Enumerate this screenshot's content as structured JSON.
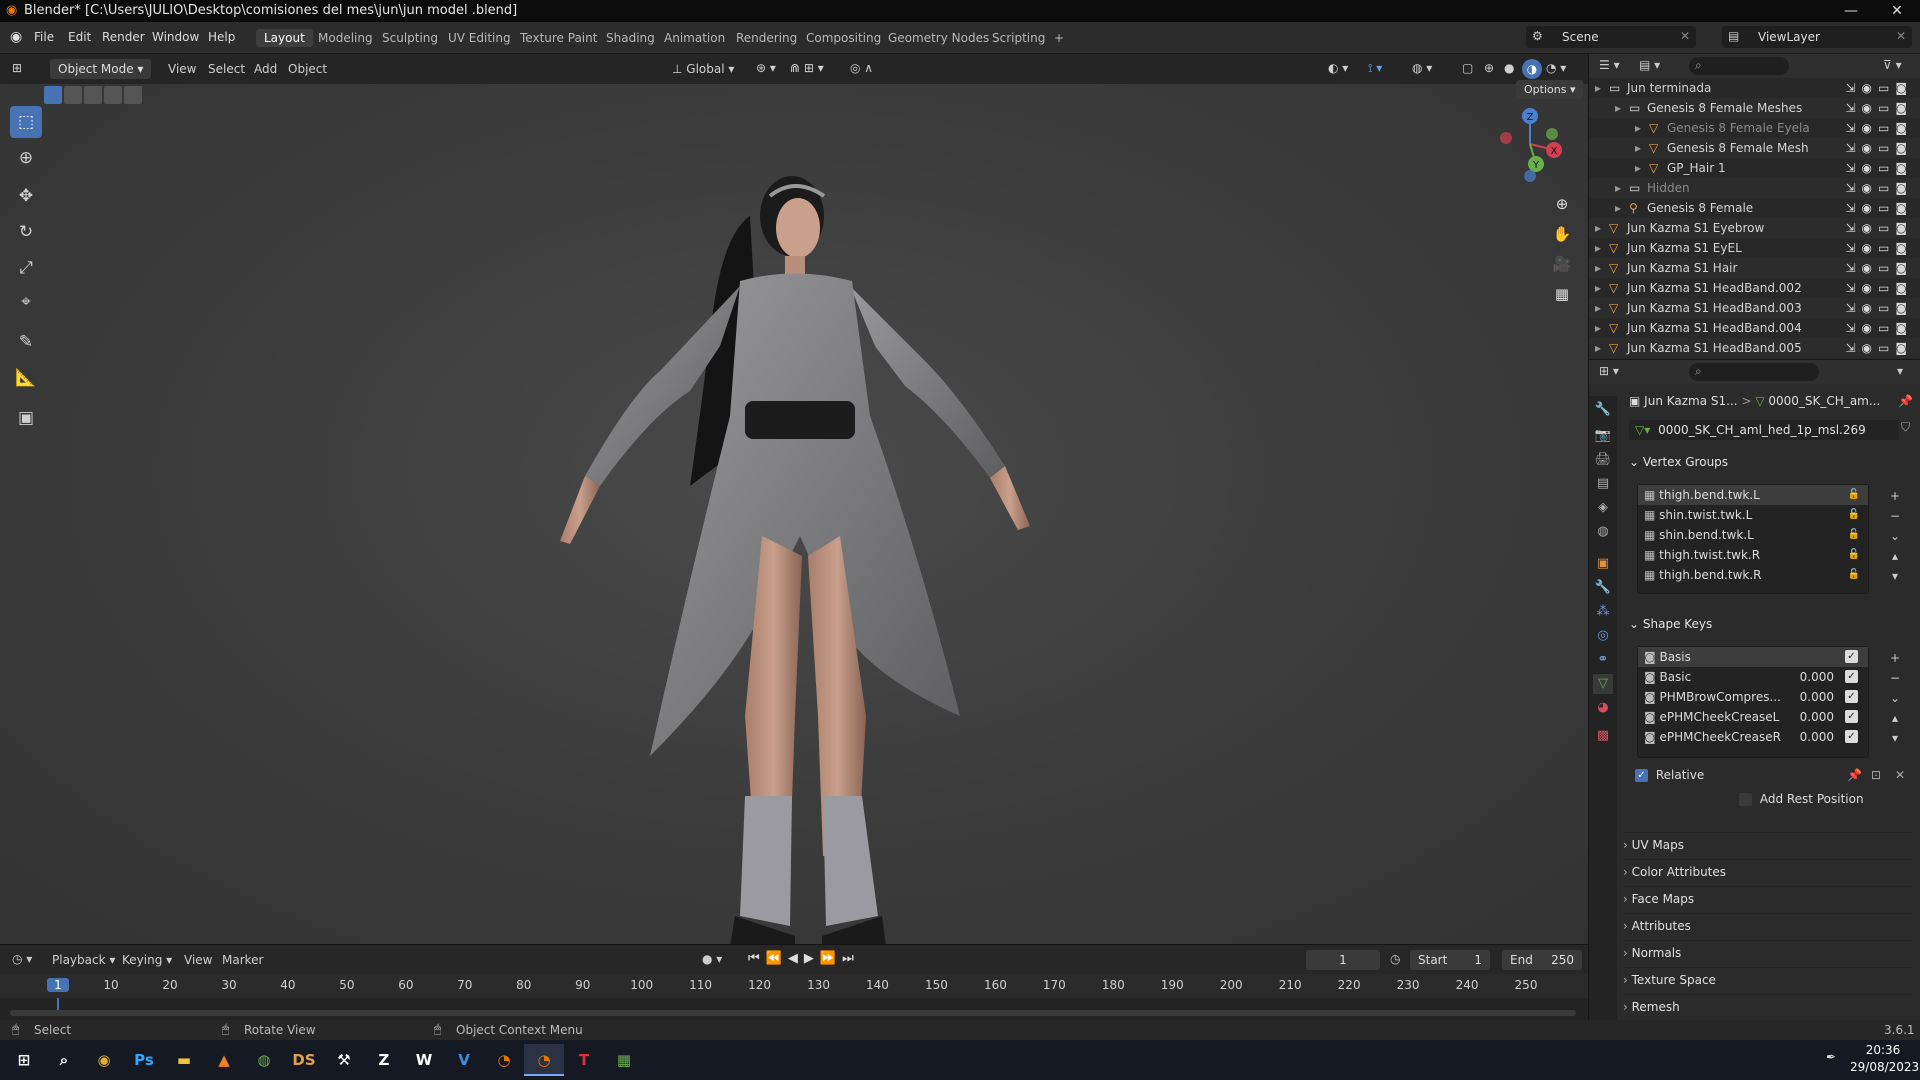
{
  "titlebar": {
    "title": "Blender* [C:\\Users\\JULIO\\Desktop\\comisiones del mes\\jun\\jun model .blend]",
    "min": "—",
    "max": "❐",
    "close": "✕"
  },
  "menubar": {
    "menus": [
      "File",
      "Edit",
      "Render",
      "Window",
      "Help"
    ],
    "workspaces": [
      "Layout",
      "Modeling",
      "Sculpting",
      "UV Editing",
      "Texture Paint",
      "Shading",
      "Animation",
      "Rendering",
      "Compositing",
      "Geometry Nodes",
      "Scripting"
    ],
    "add_workspace": "+",
    "scene_label": "Scene",
    "viewlayer_label": "ViewLayer"
  },
  "viewport_header": {
    "mode": "Object Mode",
    "menus": [
      "View",
      "Select",
      "Add",
      "Object"
    ],
    "orientation": "Global",
    "options": "Options"
  },
  "gizmo": {
    "x": "X",
    "y": "Y",
    "z": "Z"
  },
  "outliner": {
    "rows": [
      {
        "name": "Jun terminada",
        "indent": 0,
        "type": "collection",
        "dim": false
      },
      {
        "name": "Genesis 8 Female Meshes",
        "indent": 1,
        "type": "collection",
        "dim": false
      },
      {
        "name": "Genesis 8 Female Eyela",
        "indent": 2,
        "type": "mesh",
        "dim": true
      },
      {
        "name": "Genesis 8 Female Mesh",
        "indent": 2,
        "type": "mesh",
        "dim": false
      },
      {
        "name": "GP_Hair 1",
        "indent": 2,
        "type": "mesh",
        "dim": false
      },
      {
        "name": "Hidden",
        "indent": 1,
        "type": "collection",
        "dim": true
      },
      {
        "name": "Genesis 8 Female",
        "indent": 1,
        "type": "armature",
        "dim": false
      },
      {
        "name": "Jun Kazma S1 Eyebrow",
        "indent": 0,
        "type": "mesh",
        "dim": false
      },
      {
        "name": "Jun Kazma S1 EyEL",
        "indent": 0,
        "type": "mesh",
        "dim": false
      },
      {
        "name": "Jun Kazma S1 Hair",
        "indent": 0,
        "type": "mesh",
        "dim": false
      },
      {
        "name": "Jun Kazma S1 HeadBand.002",
        "indent": 0,
        "type": "mesh",
        "dim": false
      },
      {
        "name": "Jun Kazma S1 HeadBand.003",
        "indent": 0,
        "type": "mesh",
        "dim": false
      },
      {
        "name": "Jun Kazma S1 HeadBand.004",
        "indent": 0,
        "type": "mesh",
        "dim": false
      },
      {
        "name": "Jun Kazma S1 HeadBand.005",
        "indent": 0,
        "type": "mesh",
        "dim": false
      }
    ]
  },
  "properties": {
    "breadcrumb_object": "Jun Kazma S1...",
    "breadcrumb_sep": ">",
    "breadcrumb_data": "0000_SK_CH_am...",
    "data_name": "0000_SK_CH_aml_hed_1p_msl.269",
    "vertex_groups": {
      "title": "Vertex Groups",
      "items": [
        "thigh.bend.twk.L",
        "shin.twist.twk.L",
        "shin.bend.twk.L",
        "thigh.twist.twk.R",
        "thigh.bend.twk.R"
      ]
    },
    "shape_keys": {
      "title": "Shape Keys",
      "items": [
        {
          "name": "Basis",
          "value": ""
        },
        {
          "name": "Basic",
          "value": "0.000"
        },
        {
          "name": "PHMBrowCompres...",
          "value": "0.000"
        },
        {
          "name": "ePHMCheekCreaseL",
          "value": "0.000"
        },
        {
          "name": "ePHMCheekCreaseR",
          "value": "0.000"
        }
      ],
      "relative_label": "Relative",
      "add_rest_label": "Add Rest Position"
    },
    "collapsed_panels": [
      "UV Maps",
      "Color Attributes",
      "Face Maps",
      "Attributes",
      "Normals",
      "Texture Space",
      "Remesh"
    ]
  },
  "timeline": {
    "menus": [
      "Playback",
      "Keying",
      "View",
      "Marker"
    ],
    "current_frame": "1",
    "start_label": "Start",
    "start_value": "1",
    "end_label": "End",
    "end_value": "250",
    "ticks": [
      "1",
      "10",
      "20",
      "30",
      "40",
      "50",
      "60",
      "70",
      "80",
      "90",
      "100",
      "110",
      "120",
      "130",
      "140",
      "150",
      "160",
      "170",
      "180",
      "190",
      "200",
      "210",
      "220",
      "230",
      "240",
      "250"
    ]
  },
  "statusbar": {
    "select": "Select",
    "rotate": "Rotate View",
    "context": "Object Context Menu",
    "version": "3.6.1"
  },
  "taskbar": {
    "time": "20:36",
    "date": "29/08/2023",
    "apps": [
      "start",
      "search",
      "chrome",
      "photoshop",
      "explorer",
      "vlc",
      "app-green",
      "daz-studio",
      "tools",
      "zbrush",
      "word",
      "visual-studio",
      "blender",
      "blender-active",
      "tekken",
      "app-misc"
    ]
  },
  "colors": {
    "accent": "#4772b3",
    "mesh_icon": "#e0a050",
    "bg": "#1d1d1d"
  }
}
